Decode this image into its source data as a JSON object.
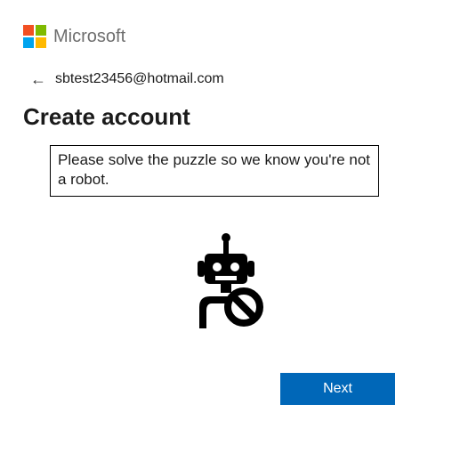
{
  "brand": {
    "name": "Microsoft"
  },
  "account": {
    "email": "sbtest23456@hotmail.com"
  },
  "page": {
    "title": "Create account",
    "instruction": "Please solve the puzzle so we know you're not a robot."
  },
  "buttons": {
    "next": "Next"
  },
  "colors": {
    "primary": "#0067b8"
  }
}
